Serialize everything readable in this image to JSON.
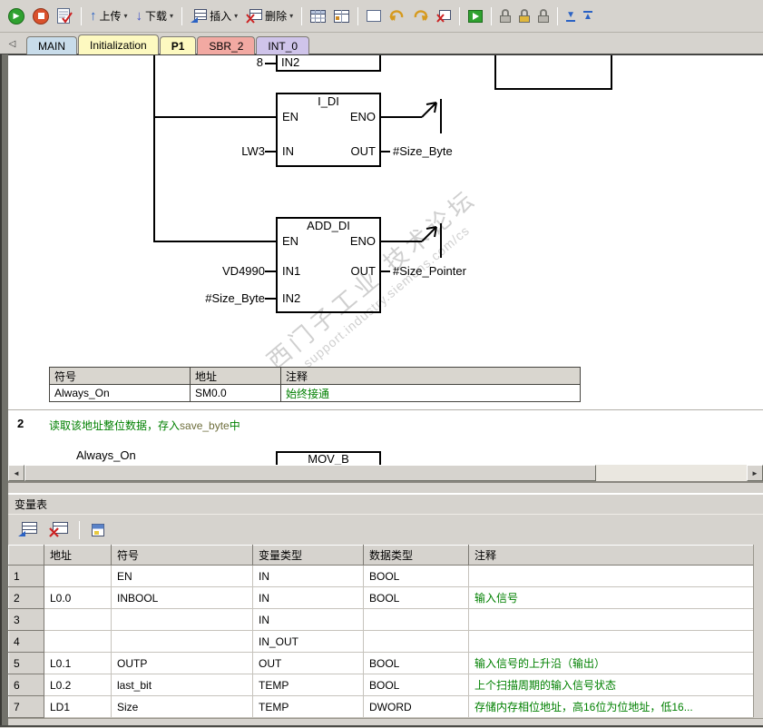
{
  "colors": {
    "toolbar_bg": "#d6d3ce",
    "comment_green": "#008000",
    "tab_main": "#c8dcea",
    "tab_yellow": "#fdf9c0",
    "tab_sbr2": "#f2a9a2",
    "tab_int0": "#cfc4ea",
    "run_green": "#2fa12f",
    "stop_red": "#d9512c"
  },
  "toolbar": {
    "upload": "上传",
    "download": "下载",
    "insert": "插入",
    "delete": "删除"
  },
  "tabs": {
    "items": [
      {
        "label": "MAIN"
      },
      {
        "label": "Initialization"
      },
      {
        "label": "P1"
      },
      {
        "label": "SBR_2"
      },
      {
        "label": "INT_0"
      }
    ]
  },
  "ladder": {
    "frag_val": "8",
    "frag_port": "IN2",
    "idi": {
      "title": "I_DI",
      "en": "EN",
      "eno": "ENO",
      "in_port": "IN",
      "out_port": "OUT",
      "in_val": "LW3",
      "out_val": "#Size_Byte"
    },
    "adddi": {
      "title": "ADD_DI",
      "en": "EN",
      "eno": "ENO",
      "in1_port": "IN1",
      "in2_port": "IN2",
      "out_port": "OUT",
      "in1_val": "VD4990",
      "in2_val": "#Size_Byte",
      "out_val": "#Size_Pointer"
    },
    "symtable": {
      "headers": {
        "symbol": "符号",
        "address": "地址",
        "comment": "注释"
      },
      "row": {
        "symbol": "Always_On",
        "address": "SM0.0",
        "comment": "始终接通"
      }
    },
    "network2": {
      "number": "2",
      "comment_pre": "读取该地址整位数据，存入",
      "comment_code": "save_byte",
      "comment_post": "中",
      "contact": "Always_On",
      "block_title": "MOV_B"
    },
    "watermark": {
      "line1": "西门子工业 技术论坛",
      "line2": "support.industry.siemens.com/cs"
    }
  },
  "varpanel": {
    "title": "变量表",
    "headers": {
      "address": "地址",
      "symbol": "符号",
      "var_type": "变量类型",
      "data_type": "数据类型",
      "comment": "注释"
    },
    "rows": [
      {
        "num": "1",
        "address": "",
        "symbol": "EN",
        "var_type": "IN",
        "data_type": "BOOL",
        "comment": ""
      },
      {
        "num": "2",
        "address": "L0.0",
        "symbol": "INBOOL",
        "var_type": "IN",
        "data_type": "BOOL",
        "comment": "输入信号"
      },
      {
        "num": "3",
        "address": "",
        "symbol": "",
        "var_type": "IN",
        "data_type": "",
        "comment": ""
      },
      {
        "num": "4",
        "address": "",
        "symbol": "",
        "var_type": "IN_OUT",
        "data_type": "",
        "comment": ""
      },
      {
        "num": "5",
        "address": "L0.1",
        "symbol": "OUTP",
        "var_type": "OUT",
        "data_type": "BOOL",
        "comment": "输入信号的上升沿（输出）"
      },
      {
        "num": "6",
        "address": "L0.2",
        "symbol": "last_bit",
        "var_type": "TEMP",
        "data_type": "BOOL",
        "comment": "上个扫描周期的输入信号状态"
      },
      {
        "num": "7",
        "address": "LD1",
        "symbol": "Size",
        "var_type": "TEMP",
        "data_type": "DWORD",
        "comment": "存储内存相位地址，高16位为位地址，低16..."
      }
    ]
  }
}
